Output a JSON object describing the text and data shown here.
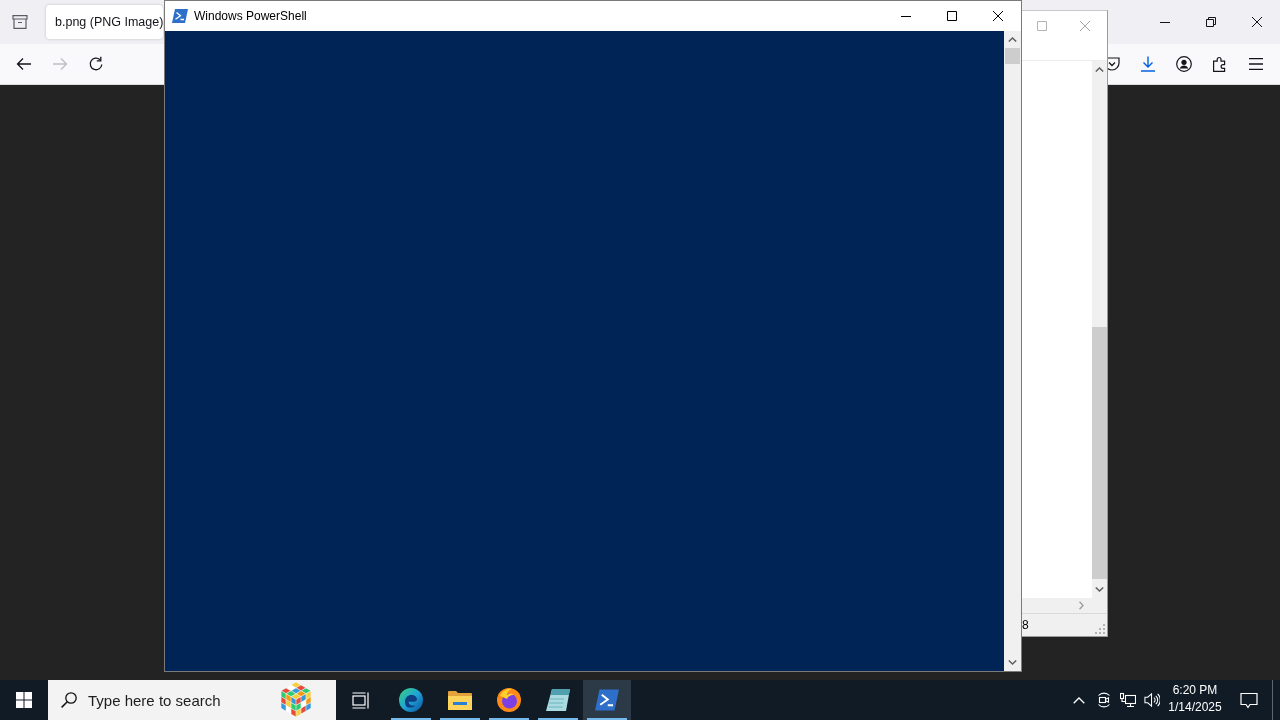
{
  "browser": {
    "tabs": [
      {
        "title": "b.png (PNG Image)",
        "selected": true
      }
    ],
    "nav_buttons": [
      {
        "kind": "back",
        "disabled": false
      },
      {
        "kind": "forward",
        "disabled": true
      },
      {
        "kind": "reload",
        "disabled": false
      }
    ],
    "toolbar_icons": [
      {
        "kind": "pocket"
      },
      {
        "kind": "download"
      },
      {
        "kind": "account"
      },
      {
        "kind": "extensions"
      },
      {
        "kind": "menu"
      }
    ]
  },
  "background_window": {
    "status_text": "8"
  },
  "powershell_window": {
    "title": "Windows PowerShell"
  },
  "taskbar": {
    "search": {
      "placeholder": "Type here to search"
    },
    "apps": [
      {
        "kind": "swirl",
        "running": true,
        "selected": false
      },
      {
        "kind": "folder",
        "running": true,
        "selected": false
      },
      {
        "kind": "flame",
        "running": true,
        "selected": false
      },
      {
        "kind": "notepad",
        "running": true,
        "selected": false
      },
      {
        "kind": "terminal",
        "running": true,
        "selected": true
      }
    ],
    "clock": {
      "time": "6:20 PM",
      "date": "1/14/2025"
    }
  }
}
